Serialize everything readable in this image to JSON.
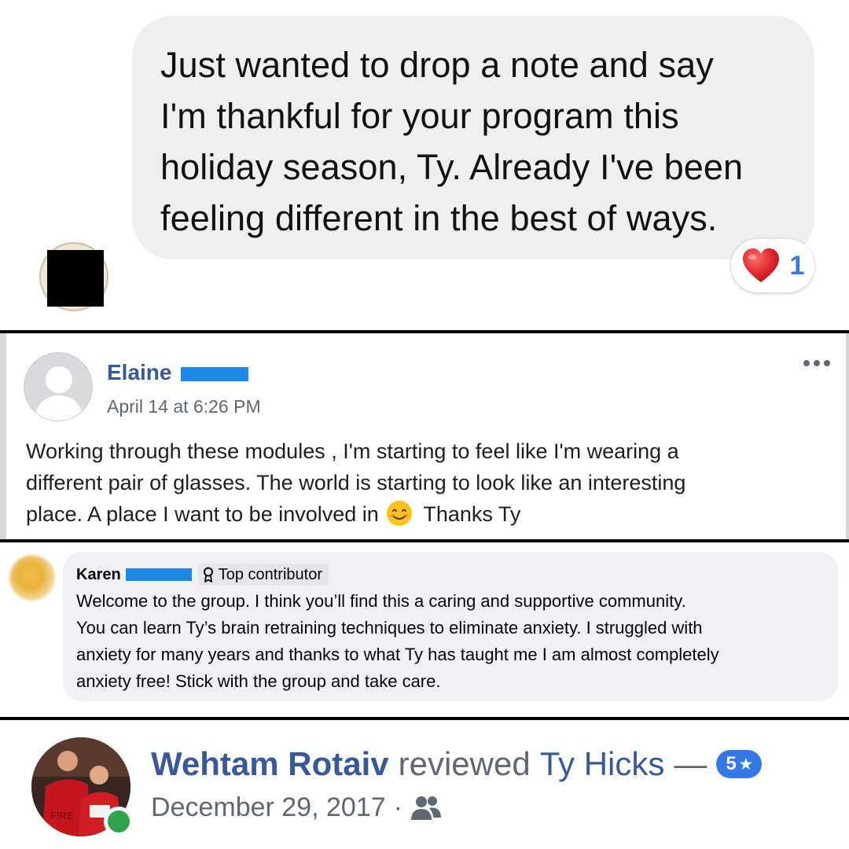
{
  "message": {
    "lines": [
      "Just wanted to drop a note and say",
      "I'm thankful for your program this",
      "holiday season, Ty. Already I've been",
      "feeling different in the best of ways."
    ],
    "reaction": {
      "icon": "heart-icon",
      "count": "1"
    }
  },
  "post": {
    "author": "Elaine",
    "time": "April 14 at 6:26 PM",
    "body_lines": [
      "Working through these modules , I'm starting to feel like I'm wearing a",
      "different pair of glasses. The world is starting to look like an interesting"
    ],
    "body_last_before_emoji": "place. A place I want to be involved in",
    "body_last_after_emoji": "Thanks Ty",
    "emoji": "smiling-face-icon"
  },
  "comment": {
    "author": "Karen",
    "badge": "Top contributor",
    "lines": [
      "Welcome to the group. I think you’ll find this a caring and supportive community.",
      "You can learn Ty’s brain retraining techniques to eliminate anxiety. I struggled with",
      "anxiety for many years and thanks to what Ty has taught me I am almost completely",
      "anxiety free! Stick with the group and take care."
    ]
  },
  "review": {
    "reviewer": "Wehtam Rotaiv",
    "verb": "reviewed",
    "page": "Ty Hicks",
    "dash": "—",
    "rating": "5",
    "date": "December 29, 2017",
    "separator": "·",
    "audience_icon": "friends-icon"
  },
  "colors": {
    "link_blue": "#385898",
    "rating_blue": "#3578e5",
    "online_green": "#31a24c",
    "bubble_gray": "#efeff1",
    "redaction_blue": "#1e88e5"
  }
}
